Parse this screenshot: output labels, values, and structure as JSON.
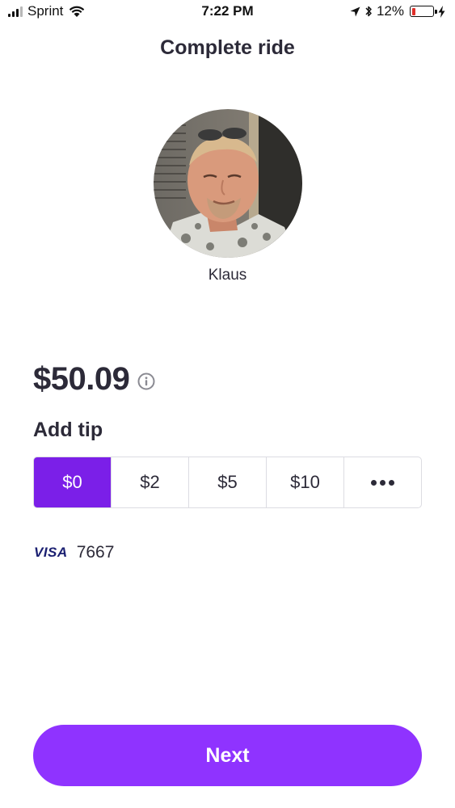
{
  "status_bar": {
    "carrier": "Sprint",
    "time": "7:22 PM",
    "battery_percent": "12%",
    "battery_level": 0.12
  },
  "header": {
    "title": "Complete ride"
  },
  "driver": {
    "name": "Klaus",
    "avatar_icon": "driver-photo"
  },
  "fare": {
    "amount": "$50.09",
    "info_icon": "info-icon"
  },
  "tip": {
    "title": "Add tip",
    "options": [
      "$0",
      "$2",
      "$5",
      "$10"
    ],
    "more_icon": "more-dots-icon",
    "selected": "$0"
  },
  "payment": {
    "brand": "VISA",
    "last4": "7667"
  },
  "actions": {
    "next_label": "Next"
  },
  "colors": {
    "accent": "#8f33ff",
    "selected_tip": "#7b1fe8",
    "text": "#2c2a38",
    "visa": "#1a1f71",
    "battery_low": "#e0302a"
  }
}
